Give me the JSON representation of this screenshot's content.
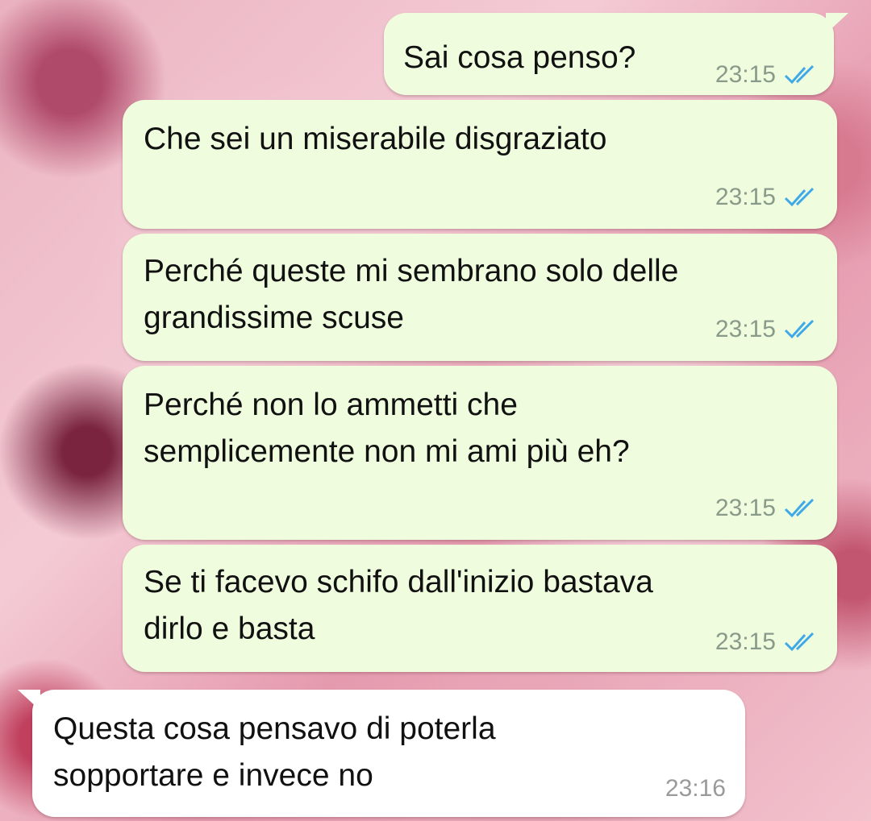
{
  "messages": [
    {
      "id": "m1",
      "direction": "out",
      "lines": [
        "Sai cosa penso?"
      ],
      "time": "23:15",
      "status": "read-double-check"
    },
    {
      "id": "m2",
      "direction": "out",
      "lines": [
        "Che sei un miserabile disgraziato"
      ],
      "time": "23:15",
      "status": "read-double-check"
    },
    {
      "id": "m3",
      "direction": "out",
      "lines": [
        "Perché queste mi sembrano solo delle",
        "grandissime scuse"
      ],
      "time": "23:15",
      "status": "read-double-check"
    },
    {
      "id": "m4",
      "direction": "out",
      "lines": [
        "Perché non lo ammetti che",
        "semplicemente non mi ami più eh?"
      ],
      "time": "23:15",
      "status": "read-double-check"
    },
    {
      "id": "m5",
      "direction": "out",
      "lines": [
        "Se ti facevo schifo dall'inizio bastava",
        "dirlo e basta"
      ],
      "time": "23:15",
      "status": "read-double-check"
    },
    {
      "id": "m6",
      "direction": "in",
      "lines": [
        "Questa cosa pensavo di poterla",
        "sopportare e invece no"
      ],
      "time": "23:16"
    }
  ],
  "colors": {
    "outgoing_bubble": "#effdde",
    "incoming_bubble": "#ffffff",
    "read_ticks": "#3fa9e8"
  },
  "icons": {
    "read_status": "double-check-icon",
    "background": "pink-roses-wallpaper"
  }
}
